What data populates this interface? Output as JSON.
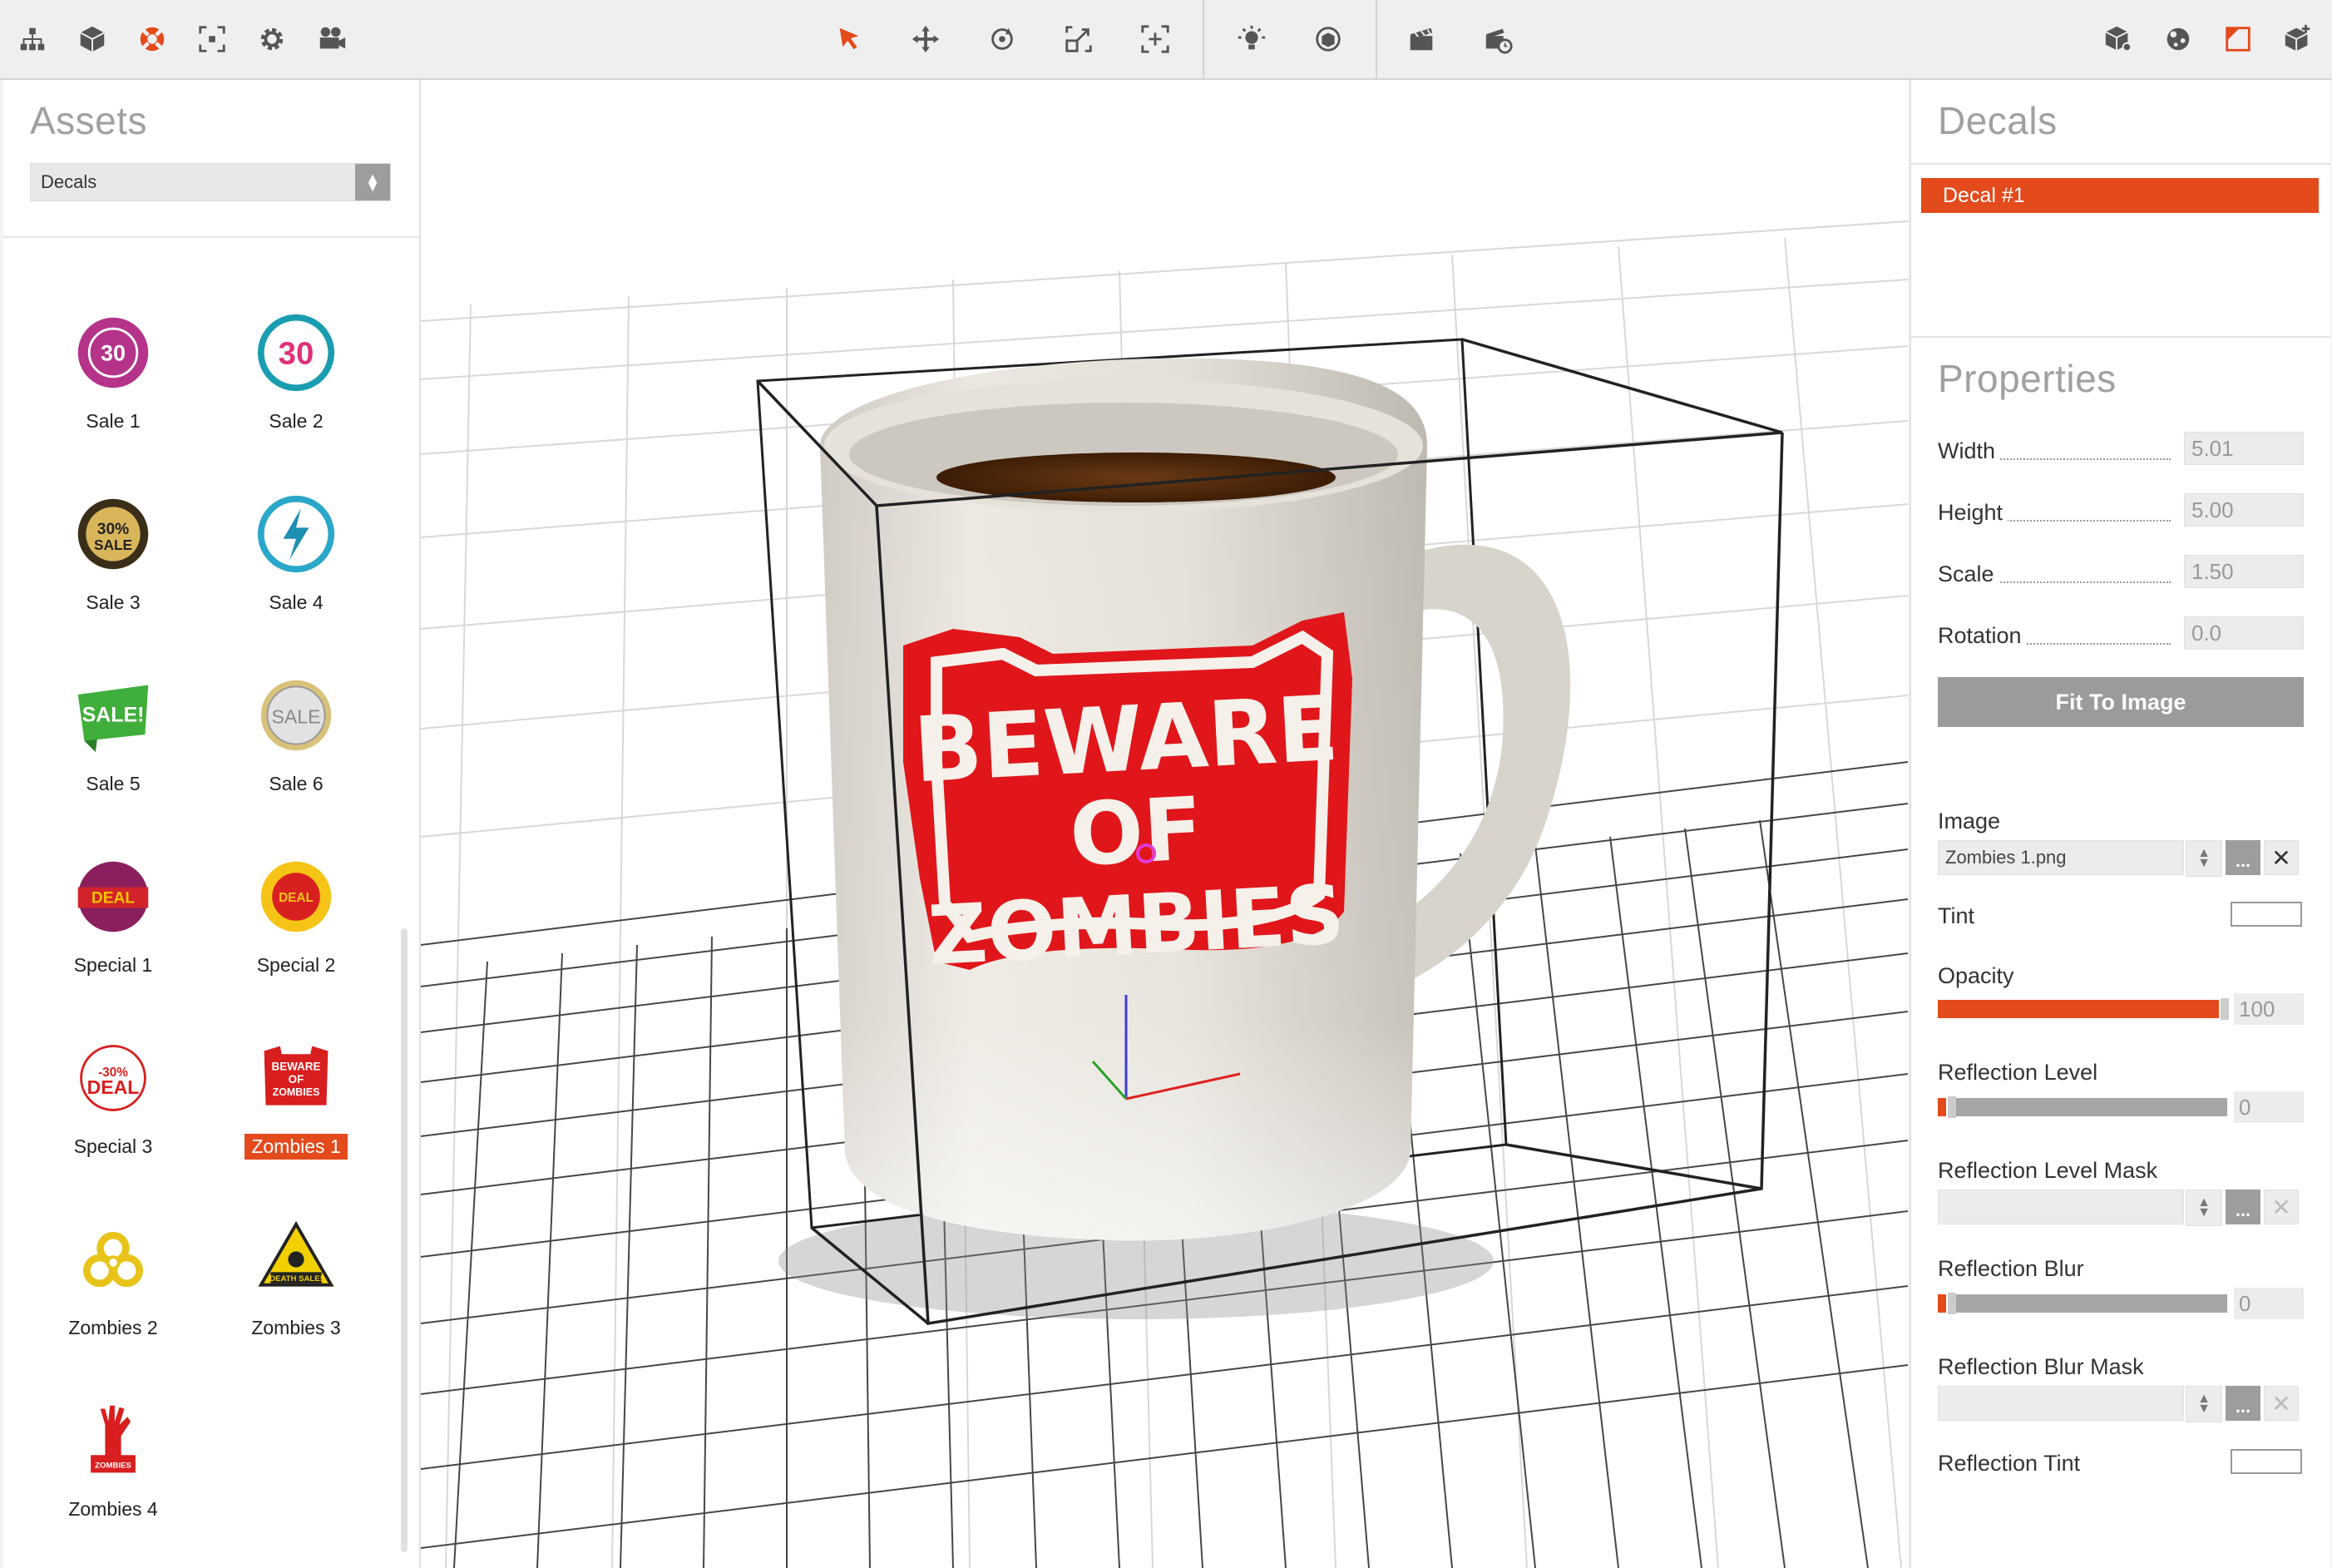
{
  "toolbar": {
    "left": [
      "scene-tree-icon",
      "object-cube-icon",
      "decal-lifebuoy-icon",
      "focus-frame-icon",
      "settings-gear-icon",
      "camera-icon"
    ],
    "tools": [
      "select-arrow-icon",
      "move-icon",
      "rotate-icon",
      "scale-icon",
      "fit-view-icon"
    ],
    "lights": [
      "light-bulb-icon",
      "environment-sphere-icon"
    ],
    "render": [
      "clapperboard-icon",
      "render-timer-icon"
    ],
    "right": [
      "material-cube-icon",
      "material-sphere-icon",
      "decal-panel-icon",
      "add-object-icon"
    ],
    "accent": "#e34a1c"
  },
  "assets": {
    "title": "Assets",
    "category": "Decals",
    "items": [
      {
        "label": "Sale 1",
        "icon": "sale-30-pink-icon"
      },
      {
        "label": "Sale 2",
        "icon": "sale-30-teal-icon"
      },
      {
        "label": "Sale 3",
        "icon": "sale-30-gold-icon"
      },
      {
        "label": "Sale 4",
        "icon": "sale-lightning-icon"
      },
      {
        "label": "Sale 5",
        "icon": "sale-green-badge-icon"
      },
      {
        "label": "Sale 6",
        "icon": "sale-silver-icon"
      },
      {
        "label": "Special 1",
        "icon": "special-deal-purple-icon"
      },
      {
        "label": "Special 2",
        "icon": "special-deal-yellow-icon"
      },
      {
        "label": "Special 3",
        "icon": "special-deal-red-icon"
      },
      {
        "label": "Zombies 1",
        "icon": "beware-of-zombies-icon",
        "selected": true
      },
      {
        "label": "Zombies 2",
        "icon": "biohazard-icon"
      },
      {
        "label": "Zombies 3",
        "icon": "death-sale-sign-icon"
      },
      {
        "label": "Zombies 4",
        "icon": "zombie-hand-icon"
      }
    ]
  },
  "viewport": {
    "decal_text": [
      "BEWARE",
      "OF",
      "ZOMBIES"
    ]
  },
  "decals": {
    "title": "Decals",
    "items": [
      "Decal #1"
    ]
  },
  "properties": {
    "title": "Properties",
    "width_label": "Width",
    "width_value": "5.01",
    "height_label": "Height",
    "height_value": "5.00",
    "scale_label": "Scale",
    "scale_value": "1.50",
    "rotation_label": "Rotation",
    "rotation_value": "0.0",
    "fit_button": "Fit To Image",
    "image_label": "Image",
    "image_value": "Zombies 1.png",
    "browse_label": "...",
    "tint_label": "Tint",
    "opacity_label": "Opacity",
    "opacity_value": "100",
    "opacity_fraction": 1.0,
    "refl_level_label": "Reflection Level",
    "refl_level_value": "0",
    "refl_level_fraction": 0.0,
    "refl_level_mask_label": "Reflection Level Mask",
    "refl_blur_label": "Reflection Blur",
    "refl_blur_value": "0",
    "refl_blur_fraction": 0.0,
    "refl_blur_mask_label": "Reflection Blur Mask",
    "refl_tint_label": "Reflection Tint"
  }
}
